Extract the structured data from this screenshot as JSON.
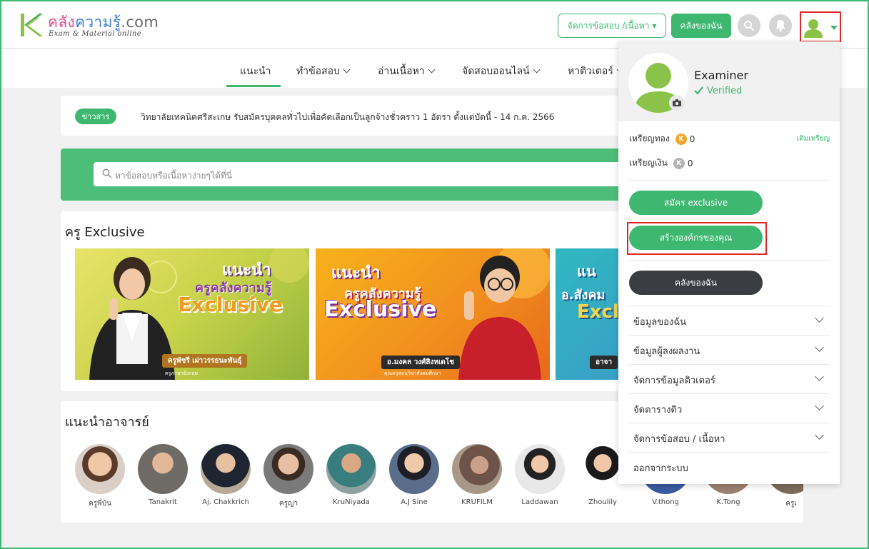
{
  "header": {
    "logo_title_1": "คลัง",
    "logo_title_2": "ความรู้",
    "logo_title_3": ".com",
    "logo_subtitle": "Exam & Material online",
    "manage_button": "จัดการข้อสอบ /เนื้อหา ▾",
    "my_library_button": "คลังของฉัน"
  },
  "nav": {
    "items": [
      {
        "label": "แนะนำ"
      },
      {
        "label": "ทำข้อสอบ"
      },
      {
        "label": "อ่านเนื้อหา"
      },
      {
        "label": "จัดสอบออนไลน์"
      },
      {
        "label": "หาติวเตอร์"
      }
    ]
  },
  "news": {
    "badge": "ข่าวสาร",
    "text": "วิทยาลัยเทคนิคศรีสะเกษ รับสมัครบุคคลทั่วไปเพื่อคัดเลือกเป็นลูกจ้างชั่วคราว 1 อัตรา ตั้งแต่บัดนี้ - 14 ก.ค. 2566"
  },
  "search": {
    "placeholder": "หาข้อสอบหรือเนื้อหาง่ายๆได้ที่นี่"
  },
  "exclusive": {
    "title": "ครู Exclusive",
    "cards": [
      {
        "line1": "แนะนำ",
        "line2": "ครูคลังความรู้",
        "line3": "Exclusive",
        "name": "ครูพัชรี เผ่าวรรธนะพันธุ์",
        "sub": "ครูภาษาอังกฤษ"
      },
      {
        "line1": "แนะนำ",
        "line2": "ครูคลังความรู้",
        "line3": "Exclusive",
        "name": "อ.มงคล วงศ์สิงหเดโช",
        "sub": "คุณครูสอนวิชาสังคมศึกษา"
      },
      {
        "line1": "แน",
        "line2": "อ.สังคม",
        "line3": "Excl",
        "name": "อาจา",
        "sub": ""
      }
    ]
  },
  "teachers": {
    "title": "แนะนำอาจารย์",
    "items": [
      {
        "name": "ครูพี่บัน"
      },
      {
        "name": "Tanakrit"
      },
      {
        "name": "Aj. Chakkrich"
      },
      {
        "name": "ครูญา"
      },
      {
        "name": "KruNiyada"
      },
      {
        "name": "A.J Sine"
      },
      {
        "name": "KRUFILM"
      },
      {
        "name": "Laddawan"
      },
      {
        "name": "Zhoulily"
      },
      {
        "name": "V.thong"
      },
      {
        "name": "K.Tong"
      },
      {
        "name": "ครูเ"
      }
    ]
  },
  "profile_menu": {
    "name": "Examiner",
    "verified": "Verified",
    "gold_label": "เหรียญทอง",
    "gold_value": "0",
    "silver_label": "เหรียญเงิน",
    "silver_value": "0",
    "coin_letter": "K",
    "topup": "เติมเหรียญ",
    "exclusive_button": "สมัคร exclusive",
    "create_org_button": "สร้างองค์กรของคุณ",
    "library_button": "คลังของฉัน",
    "rows": [
      {
        "label": "ข้อมูลของฉัน"
      },
      {
        "label": "ข้อมูลผู้ลงผลงาน"
      },
      {
        "label": "จัดการข้อมูลติวเตอร์"
      },
      {
        "label": "จัดตารางติว"
      },
      {
        "label": "จัดการข้อสอบ / เนื้อหา"
      },
      {
        "label": "ออกจากระบบ"
      }
    ]
  },
  "colors": {
    "accent": "#3eb871",
    "annotation": "#e02a2a"
  }
}
